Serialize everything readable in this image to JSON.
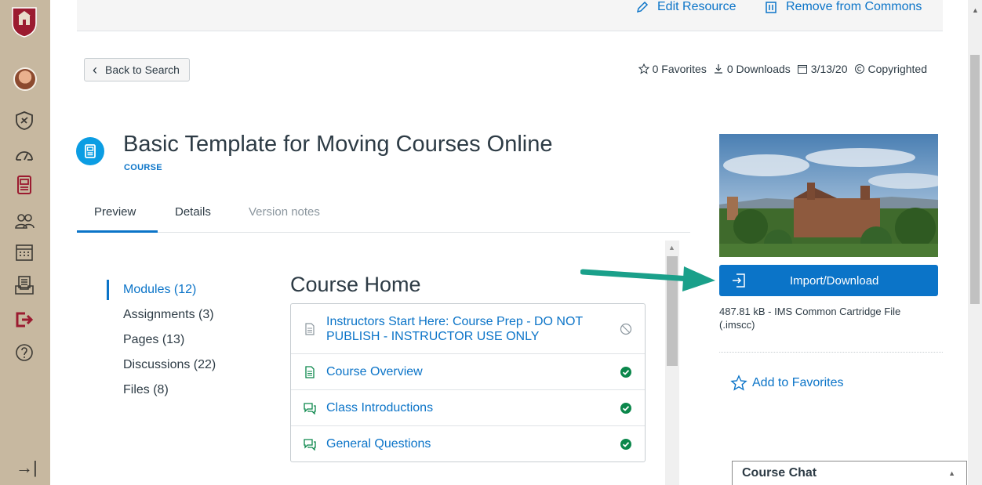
{
  "colors": {
    "accent": "#0b74c8",
    "sidebar": "#c7b8a0",
    "success": "#0b874b",
    "module_icon": "#0b874b",
    "arrow": "#1aa08a"
  },
  "sidebar": {
    "icons": [
      "university-logo",
      "user-avatar",
      "admin-icon",
      "dashboard-icon",
      "commons-icon",
      "people-icon",
      "calendar-icon",
      "inbox-icon",
      "logout-icon",
      "help-icon"
    ],
    "collapse_icon": "→|"
  },
  "topbar": {
    "edit_label": "Edit Resource",
    "remove_label": "Remove from Commons"
  },
  "back_button": {
    "label": "Back to Search"
  },
  "meta": {
    "favorites": "0 Favorites",
    "downloads": "0 Downloads",
    "date": "3/13/20",
    "license": "Copyrighted"
  },
  "resource": {
    "title": "Basic Template for Moving Courses Online",
    "type": "COURSE"
  },
  "tabs": [
    {
      "label": "Preview",
      "active": true
    },
    {
      "label": "Details",
      "active": false
    },
    {
      "label": "Version notes",
      "active": false
    }
  ],
  "left_nav": [
    {
      "label": "Modules (12)",
      "active": true
    },
    {
      "label": "Assignments (3)",
      "active": false
    },
    {
      "label": "Pages (13)",
      "active": false
    },
    {
      "label": "Discussions (22)",
      "active": false
    },
    {
      "label": "Files (8)",
      "active": false
    }
  ],
  "course_home": {
    "heading": "Course Home",
    "items": [
      {
        "label": "Instructors Start Here: Course Prep - DO NOT PUBLISH - INSTRUCTOR USE ONLY",
        "icon": "page-icon",
        "status": "unpublished"
      },
      {
        "label": "Course Overview",
        "icon": "page-icon",
        "status": "published"
      },
      {
        "label": "Class Introductions",
        "icon": "discussion-icon",
        "status": "published"
      },
      {
        "label": "General Questions",
        "icon": "discussion-icon",
        "status": "published"
      }
    ]
  },
  "sidebar_panel": {
    "import_label": "Import/Download",
    "file_info": "487.81 kB - IMS Common Cartridge File (.imscc)",
    "favorite_label": "Add to Favorites"
  },
  "chat": {
    "title": "Course Chat"
  }
}
